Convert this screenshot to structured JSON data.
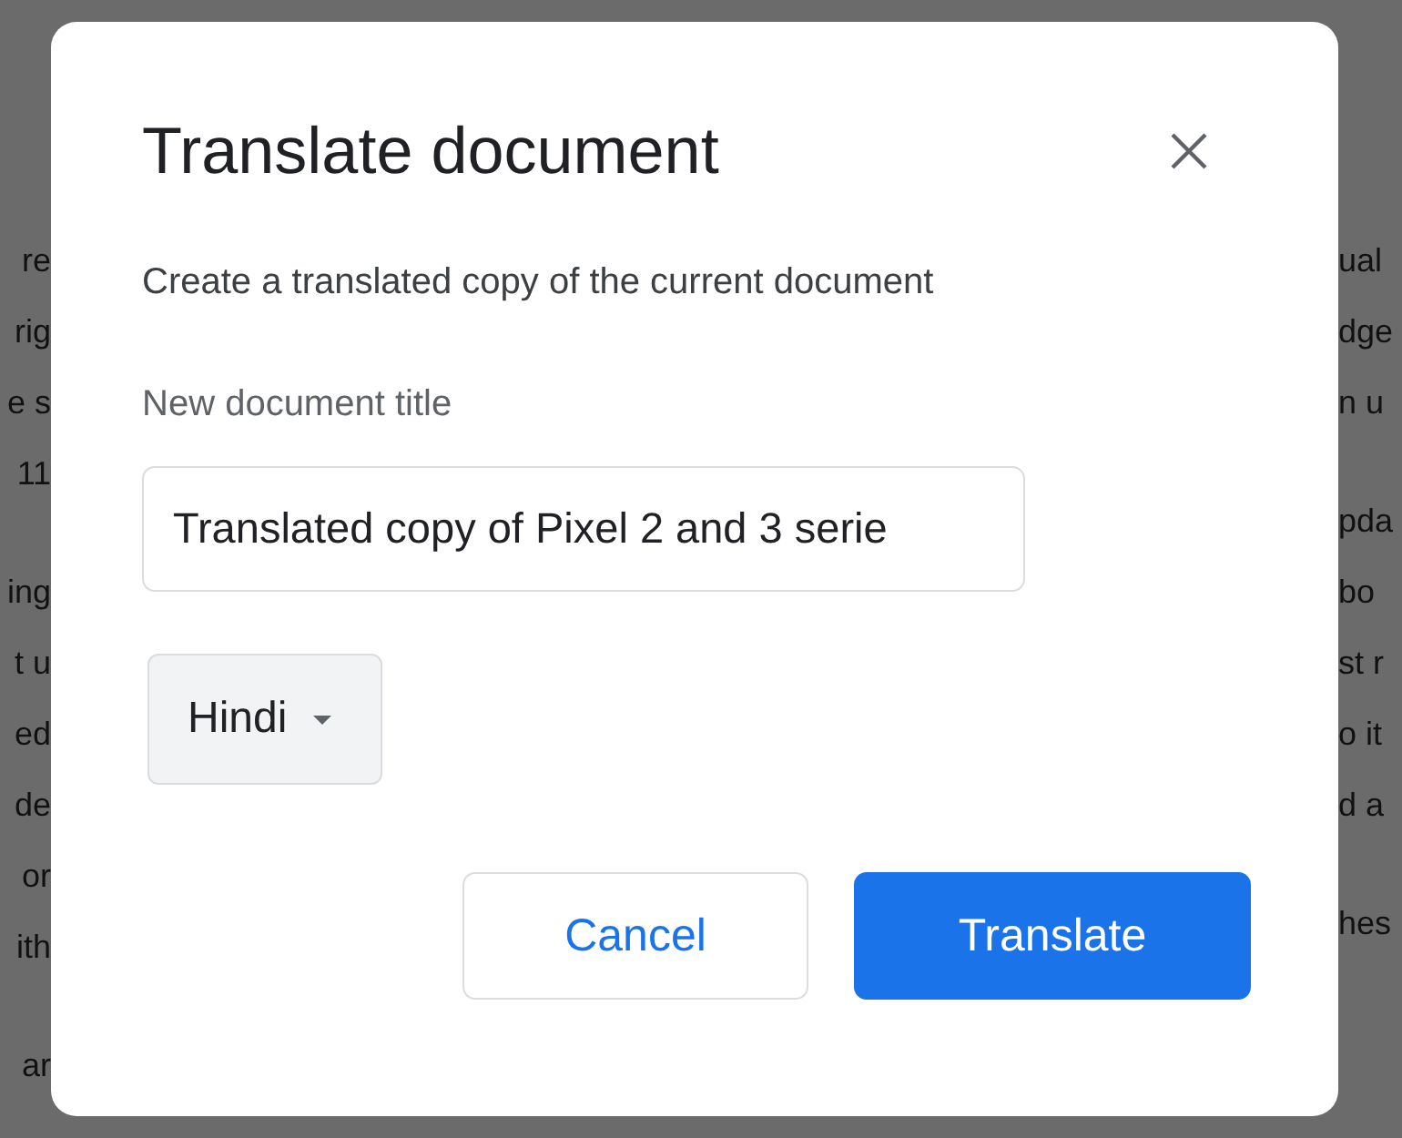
{
  "background_document": {
    "left_paragraphs": [
      [
        "re",
        "rig",
        "e s",
        "11"
      ],
      [
        "ing",
        "t u",
        "ed",
        "de",
        "or",
        "ith"
      ],
      [
        "ar"
      ]
    ],
    "right_paragraphs": [
      [
        "ual",
        "dge",
        "n u"
      ],
      [
        "pda",
        "bo",
        "st r",
        "o it",
        "d a"
      ],
      [
        "hes"
      ]
    ]
  },
  "dialog": {
    "title": "Translate document",
    "description": "Create a translated copy of the current document",
    "field_label": "New document title",
    "title_field": {
      "value": "Translated copy of Pixel 2 and 3 serie"
    },
    "language_dropdown": {
      "value": "Hindi"
    },
    "buttons": [
      {
        "label": "Cancel",
        "kind": "secondary"
      },
      {
        "label": "Translate",
        "kind": "primary"
      }
    ]
  }
}
